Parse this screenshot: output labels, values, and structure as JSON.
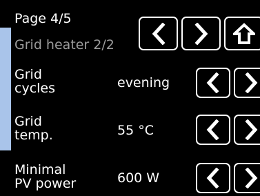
{
  "header": {
    "page_label": "Page 4/5",
    "subtitle": "Grid heater 2/2"
  },
  "nav": {
    "prev_icon": "chevron-left-icon",
    "next_icon": "chevron-right-icon",
    "home_icon": "home-icon"
  },
  "rows": [
    {
      "label": "Grid\ncycles",
      "value": "evening"
    },
    {
      "label": "Grid\ntemp.",
      "value": "55 °C"
    },
    {
      "label": "Minimal\nPV power",
      "value": "600 W"
    }
  ],
  "colors": {
    "background": "#000000",
    "accent_bar": "#a9c4ea",
    "subtitle_text": "#9c9c9c",
    "button_border": "#ffffff"
  }
}
